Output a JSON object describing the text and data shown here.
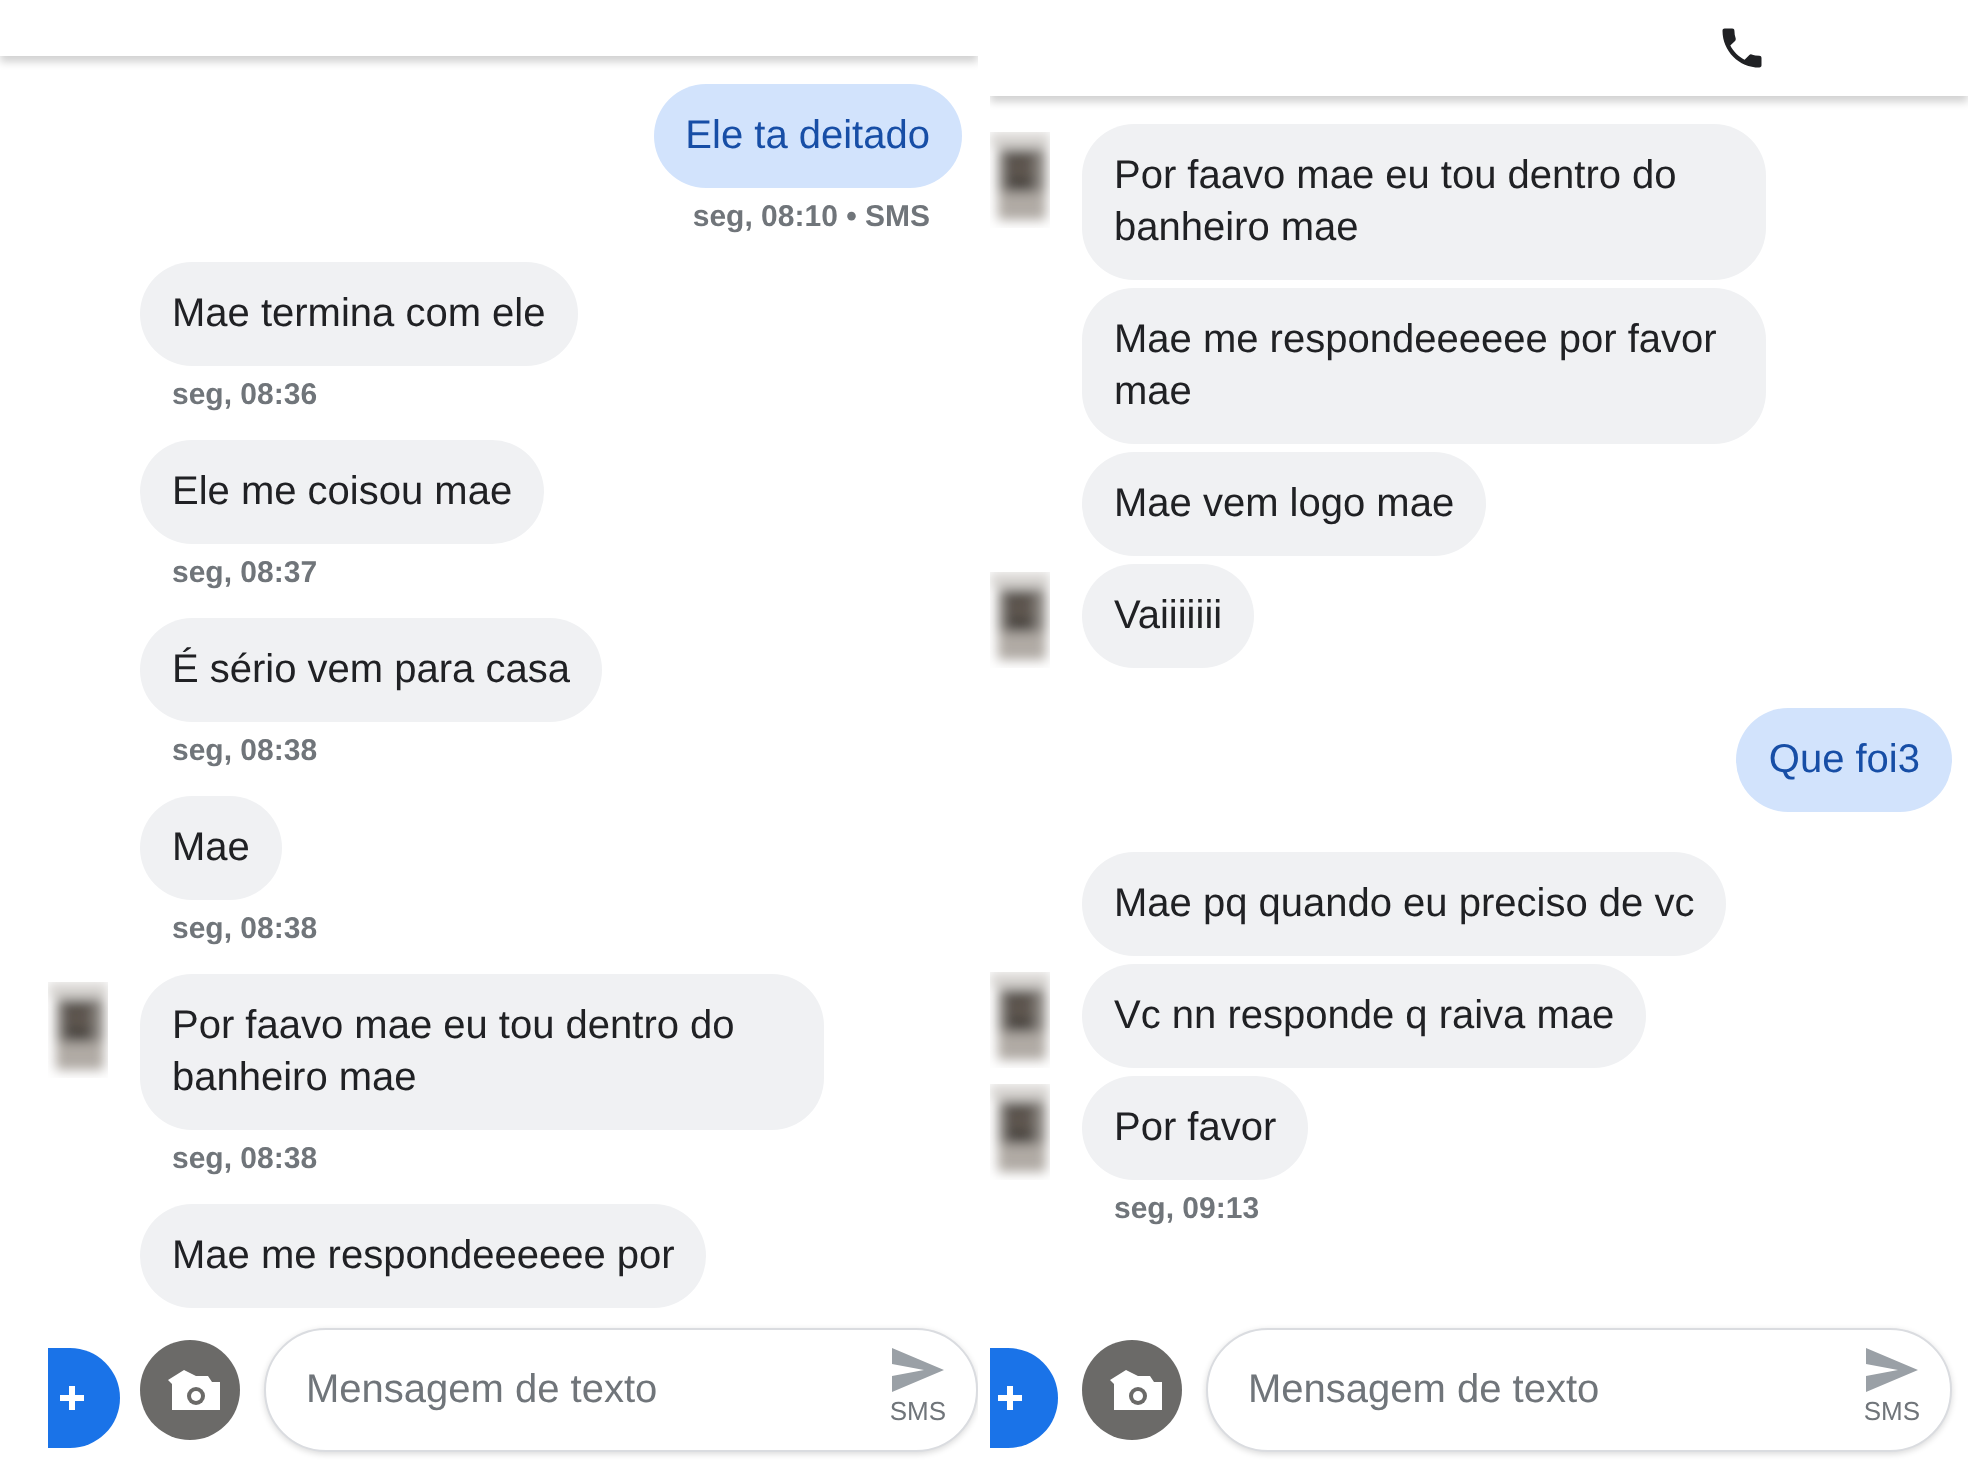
{
  "panels": [
    {
      "header": {
        "call_button": false
      },
      "messages": [
        {
          "kind": "outgoing",
          "text": "Ele ta deitado",
          "time": "seg, 08:10 • SMS",
          "avatar": false
        },
        {
          "kind": "incoming",
          "text": "Mae termina com ele",
          "time": "seg, 08:36",
          "avatar": false
        },
        {
          "kind": "incoming",
          "text": "Ele me coisou mae",
          "time": "seg, 08:37",
          "avatar": false
        },
        {
          "kind": "incoming",
          "text": "É sério vem para casa",
          "time": "seg, 08:38",
          "avatar": false
        },
        {
          "kind": "incoming",
          "text": "Mae",
          "time": "seg, 08:38",
          "avatar": false
        },
        {
          "kind": "incoming",
          "text": "Por faavo mae eu tou dentro do banheiro mae",
          "time": "seg, 08:38",
          "avatar": true
        },
        {
          "kind": "incoming",
          "text": "Mae me respondeeeeee por",
          "avatar": false
        }
      ],
      "composer": {
        "placeholder": "Mensagem de texto",
        "send_label": "SMS"
      }
    },
    {
      "header": {
        "call_button": true
      },
      "messages": [
        {
          "kind": "incoming",
          "text": "Por faavo mae eu tou dentro do banheiro mae",
          "avatar": true
        },
        {
          "kind": "incoming",
          "text": "Mae me respondeeeeee por favor mae",
          "avatar": false
        },
        {
          "kind": "incoming",
          "text": "Mae vem logo mae",
          "avatar": false
        },
        {
          "kind": "incoming",
          "text": "Vaiiiiiii",
          "avatar": true
        },
        {
          "kind": "outgoing",
          "text": "Que foi3",
          "avatar": false
        },
        {
          "kind": "incoming",
          "text": "Mae pq quando eu preciso de vc",
          "avatar": false
        },
        {
          "kind": "incoming",
          "text": "Vc nn responde q raiva mae",
          "avatar": true
        },
        {
          "kind": "incoming",
          "text": "Por favor",
          "time": "seg, 09:13",
          "avatar": true
        }
      ],
      "composer": {
        "placeholder": "Mensagem de texto",
        "send_label": "SMS"
      }
    }
  ]
}
